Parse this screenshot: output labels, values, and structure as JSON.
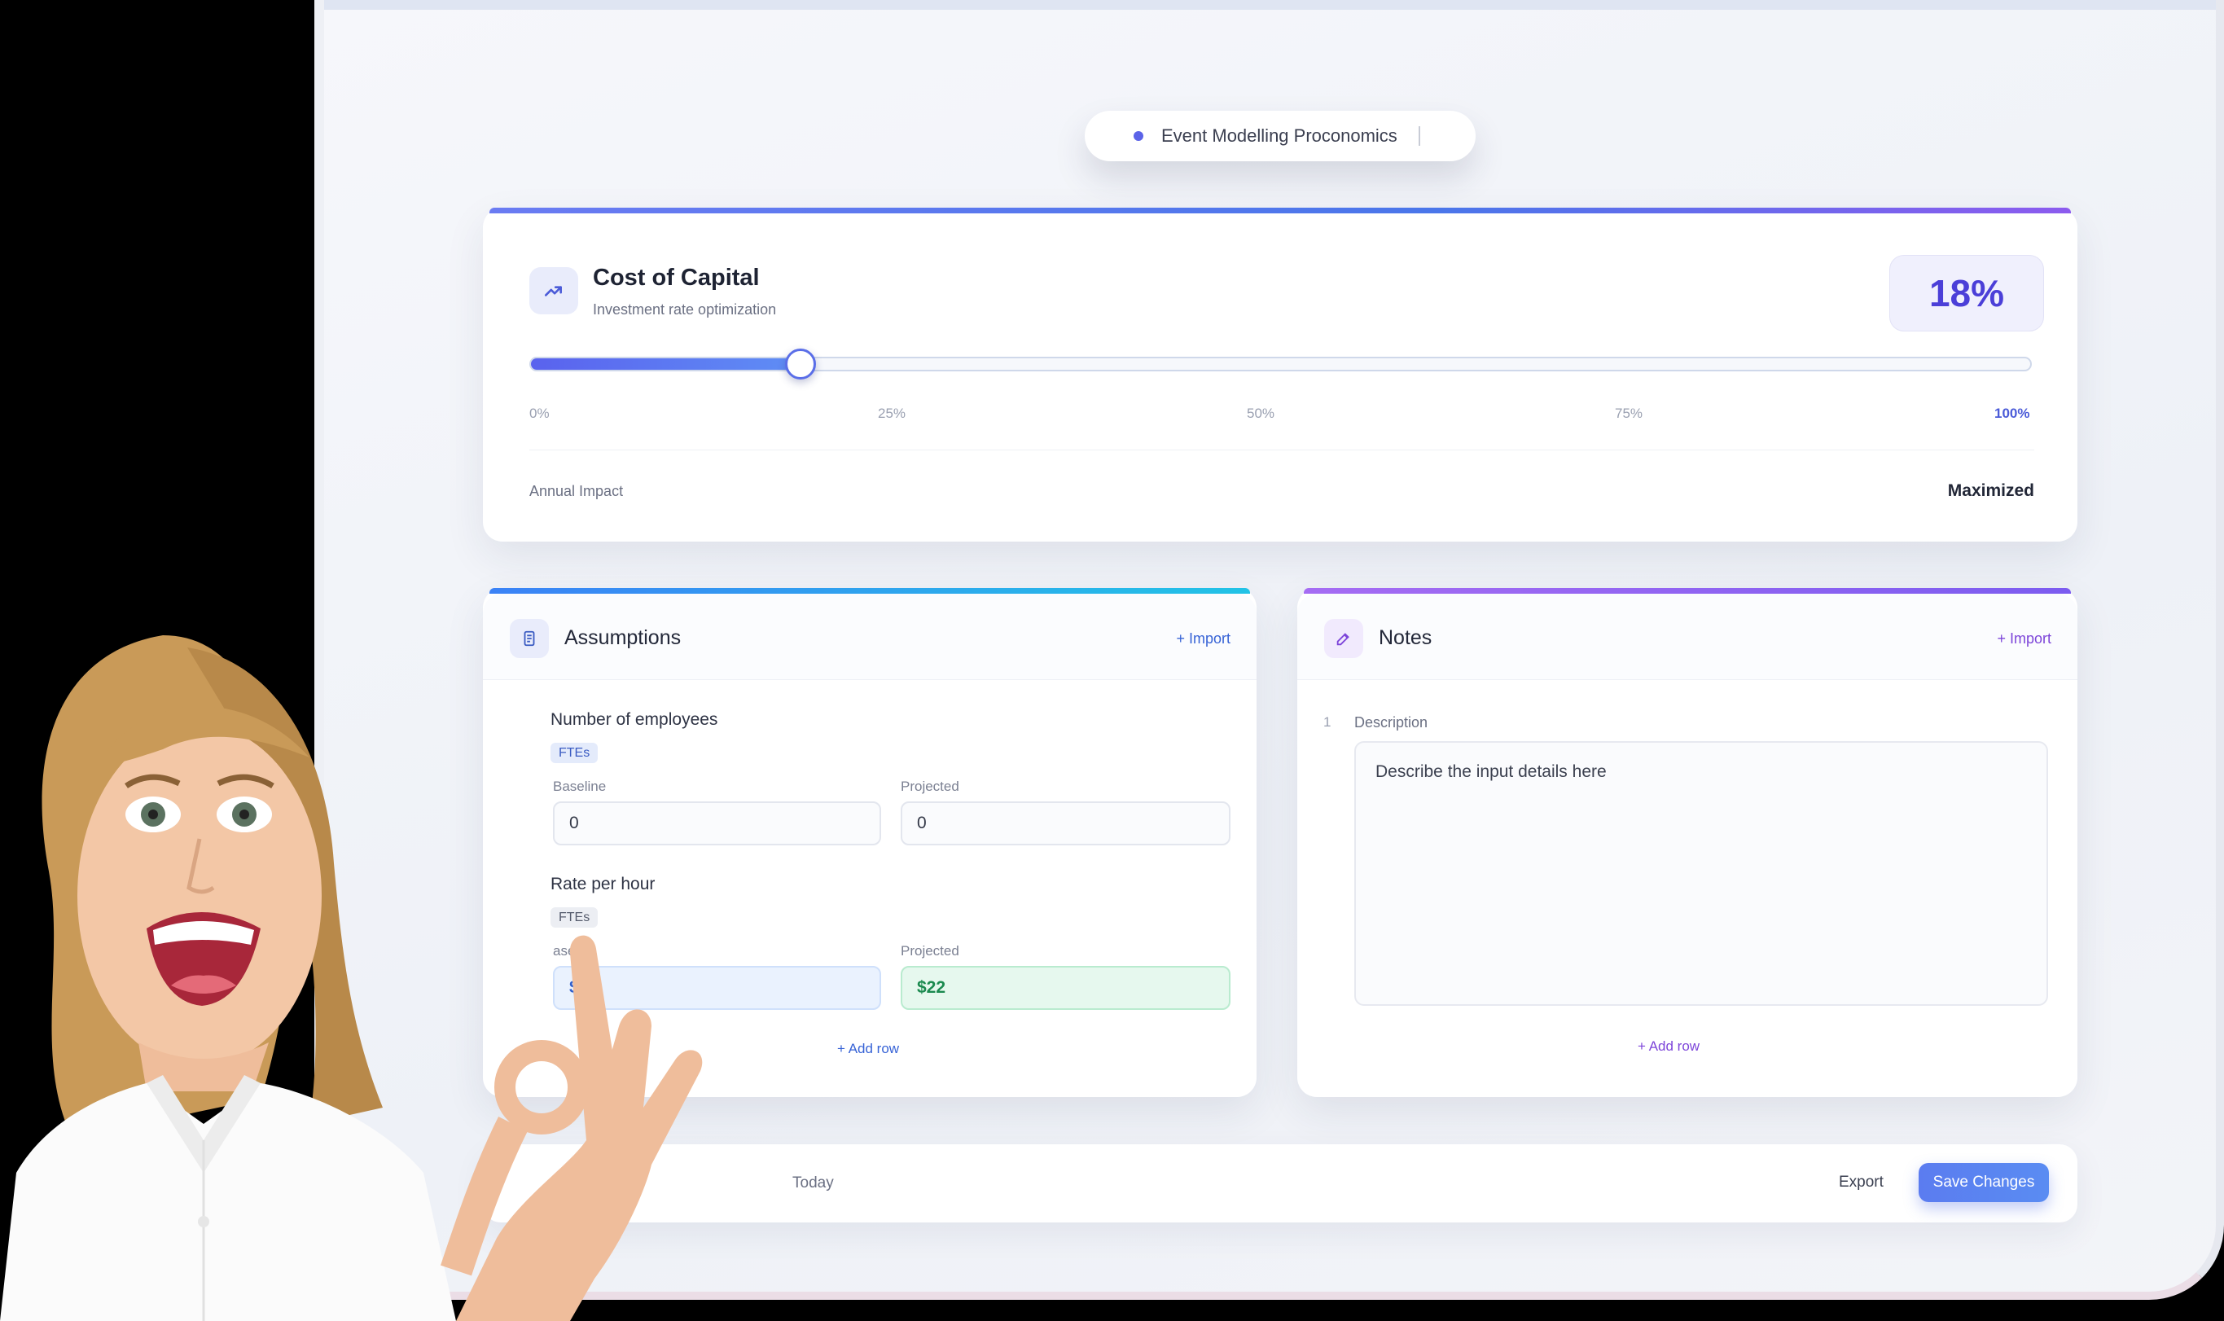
{
  "header": {
    "pill_label": "Event Modelling Proconomics"
  },
  "cost_card": {
    "title": "Cost of Capital",
    "subtitle": "Investment rate optimization",
    "value_label": "18%",
    "slider_value_percent": 18,
    "ticks": [
      "0%",
      "25%",
      "50%",
      "75%",
      "100%"
    ],
    "impact_label": "Annual Impact",
    "impact_value": "Maximized"
  },
  "assumptions": {
    "title": "Assumptions",
    "import_label": "+ Import",
    "fields": [
      {
        "label": "Number of employees",
        "tag": "FTEs",
        "baseline_label": "Baseline",
        "baseline_value": "0",
        "projected_label": "Projected",
        "projected_value": "0"
      },
      {
        "label": "Rate per hour",
        "tag": "FTEs",
        "baseline_label": "aseline",
        "baseline_value": "$28",
        "projected_label": "Projected",
        "projected_value": "$22"
      }
    ],
    "add_row_label": "+ Add row"
  },
  "notes": {
    "title": "Notes",
    "import_label": "+ Import",
    "row_number": "1",
    "description_label": "Description",
    "description_placeholder": "Describe the input details here",
    "add_row_label": "+ Add row"
  },
  "footer": {
    "today_label": "Today",
    "export_label": "Export",
    "save_label": "Save Changes"
  },
  "colors": {
    "accent": "#5b63e8",
    "value_text": "#4b3fd8",
    "save_button": "#5a86f1"
  }
}
